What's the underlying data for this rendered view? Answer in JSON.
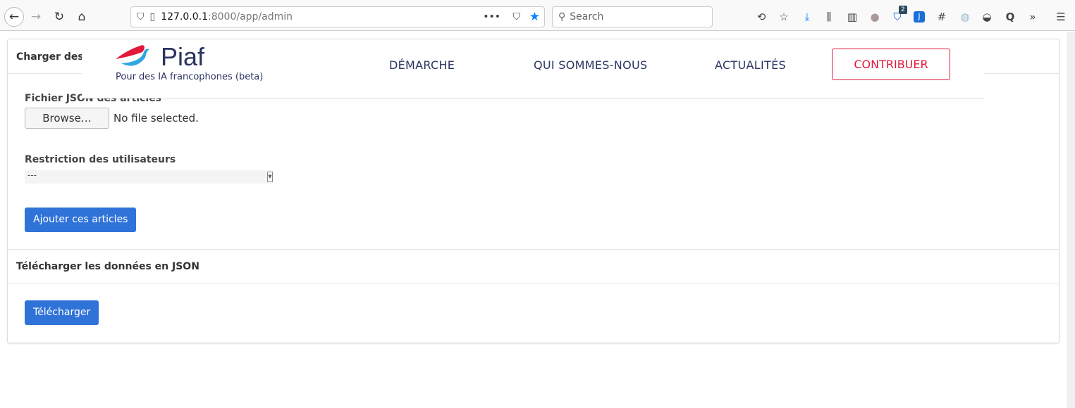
{
  "browser": {
    "url_host": "127.0.0.1",
    "url_path": ":8000/app/admin",
    "search_placeholder": "Search",
    "badge_count": "2"
  },
  "header": {
    "logo": "Piaf",
    "tagline": "Pour des IA francophones (beta)",
    "nav": [
      "DÉMARCHE",
      "QUI SOMMES-NOUS",
      "ACTUALITÉS"
    ],
    "contribute": "CONTRIBUER",
    "accent": "#e2183c"
  },
  "upload": {
    "title": "Charger des articles",
    "file_label": "Fichier JSON des articles",
    "browse": "Browse…",
    "no_file": "No file selected.",
    "restriction_label": "Restriction des utilisateurs",
    "restriction_value": "---",
    "submit": "Ajouter ces articles"
  },
  "download": {
    "title": "Télécharger les données en JSON",
    "button": "Télécharger"
  },
  "colors": {
    "primary": "#2f73d9"
  }
}
